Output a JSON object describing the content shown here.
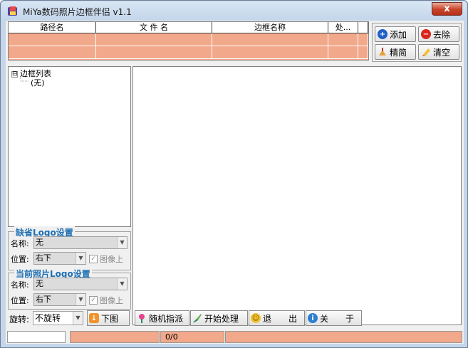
{
  "window": {
    "title": "MiYa数码照片边框伴侣 v1.1",
    "close_label": "x"
  },
  "file_table": {
    "columns": [
      "路径名",
      "文 件 名",
      "边框名称",
      "处..."
    ],
    "rows": [
      [
        "",
        "",
        "",
        ""
      ],
      [
        "",
        "",
        "",
        ""
      ]
    ]
  },
  "toolbar_top": {
    "add": "添加",
    "remove": "去除",
    "simplify": "精简",
    "clear": "清空"
  },
  "tree": {
    "root": "边框列表",
    "child": "(无)",
    "expander": "⊟"
  },
  "default_logo": {
    "title": "缺省Logo设置",
    "name_label": "名称:",
    "name_value": "无",
    "position_label": "位置:",
    "position_value": "右下",
    "image_label": "图像上"
  },
  "current_logo": {
    "title": "当前照片Logo设置",
    "name_label": "名称:",
    "name_value": "无",
    "position_label": "位置:",
    "position_value": "右下",
    "image_label": "图像上"
  },
  "bottom_bar": {
    "rotate_label": "旋转:",
    "rotate_value": "不旋转",
    "next": "下图",
    "random": "随机指派",
    "start": "开始处理",
    "exit": "退　　出",
    "about": "关　　于"
  },
  "status": {
    "progress": "0/0"
  },
  "colors": {
    "accent_salmon": "#f2a88a",
    "group_title": "#1c6fb3"
  }
}
